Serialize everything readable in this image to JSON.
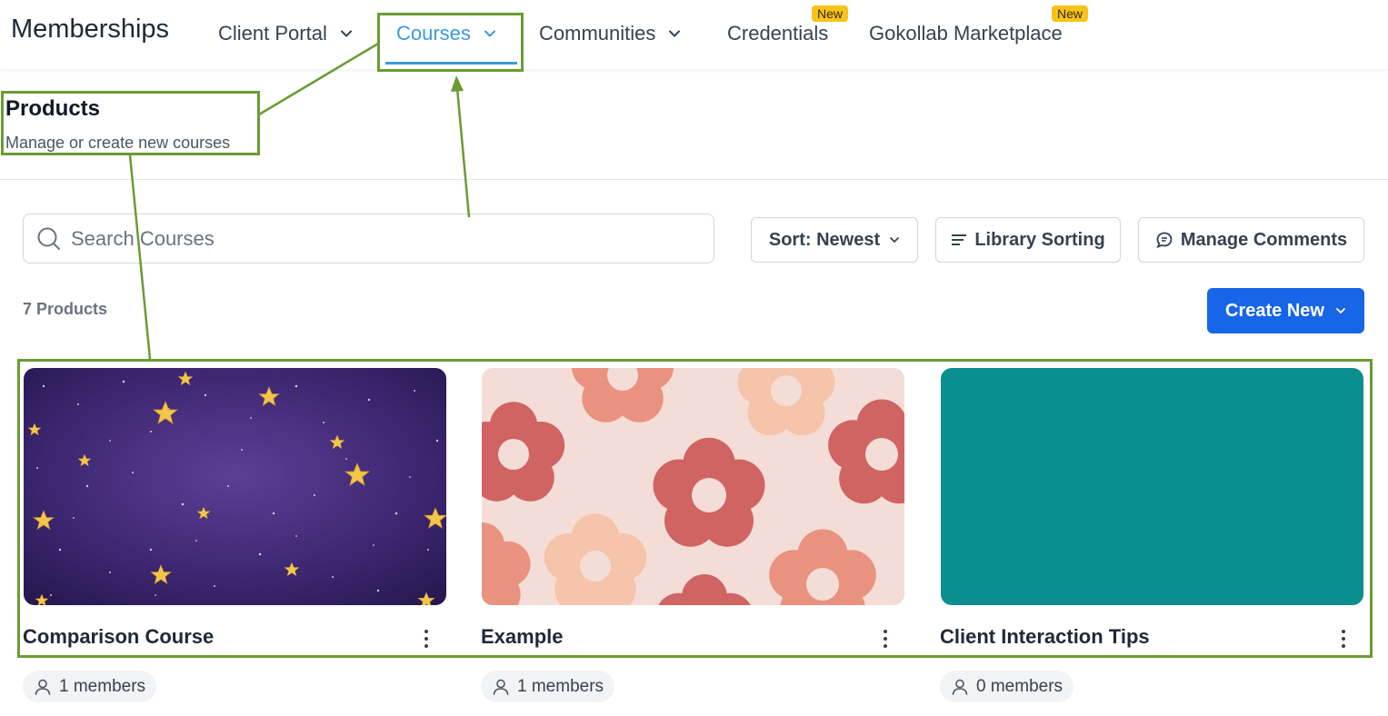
{
  "brand": "Memberships",
  "nav": {
    "client_portal": "Client Portal",
    "courses": "Courses",
    "communities": "Communities",
    "credentials": "Credentials",
    "marketplace": "Gokollab Marketplace",
    "new_badge": "New"
  },
  "header": {
    "title": "Products",
    "subtitle": "Manage or create new courses"
  },
  "search": {
    "placeholder": "Search Courses"
  },
  "toolbar": {
    "sort_label": "Sort: Newest",
    "library_sorting": "Library Sorting",
    "manage_comments": "Manage Comments"
  },
  "product_count": "7 Products",
  "create_label": "Create New",
  "products": [
    {
      "title": "Comparison Course",
      "members": "1 members",
      "thumbnail": "starry-night"
    },
    {
      "title": "Example",
      "members": "1 members",
      "thumbnail": "pink-flowers"
    },
    {
      "title": "Client Interaction Tips",
      "members": "0 members",
      "thumbnail": "teal-solid"
    }
  ],
  "colors": {
    "accent": "#3b9ad9",
    "primary_button": "#1766e8",
    "badge": "#f7c31a",
    "annotation": "#6a9c34",
    "teal_thumb": "#0a8f8e"
  }
}
